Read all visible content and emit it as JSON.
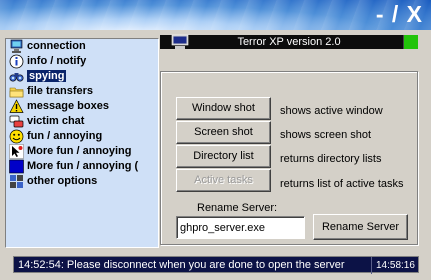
{
  "window": {
    "controls": {
      "minimize": "-",
      "separator": "/",
      "close": "X"
    },
    "title": "Terror XP version 2.0",
    "accent_color": "#0a246a",
    "status_light_color": "#22c40a"
  },
  "sidebar": {
    "items": [
      {
        "label": "connection",
        "icon": "network-globe-icon"
      },
      {
        "label": "info / notify",
        "icon": "info-icon"
      },
      {
        "label": "spying",
        "icon": "binoculars-icon",
        "selected": true
      },
      {
        "label": "file transfers",
        "icon": "folder-icon"
      },
      {
        "label": "message boxes",
        "icon": "warning-icon"
      },
      {
        "label": "victim chat",
        "icon": "chat-icon"
      },
      {
        "label": "fun / annoying",
        "icon": "smiley-icon"
      },
      {
        "label": "More fun / annoying",
        "icon": "cursor-icon"
      },
      {
        "label": "More fun / annoying (",
        "icon": "blue-screen-icon"
      },
      {
        "label": "other options",
        "icon": "grid-icon"
      }
    ]
  },
  "actions": [
    {
      "label": "Window shot",
      "description": "shows active window",
      "enabled": true
    },
    {
      "label": "Screen shot",
      "description": "shows screen shot",
      "enabled": true
    },
    {
      "label": "Directory list",
      "description": "returns directory lists",
      "enabled": true
    },
    {
      "label": "Active tasks",
      "description": "returns list of active tasks",
      "enabled": false
    }
  ],
  "rename": {
    "label": "Rename Server:",
    "value": "ghpro_server.exe",
    "button": "Rename Server"
  },
  "footer": {
    "message": "14:52:54: Please disconnect when you are done to open the server",
    "time": "14:58:16"
  }
}
